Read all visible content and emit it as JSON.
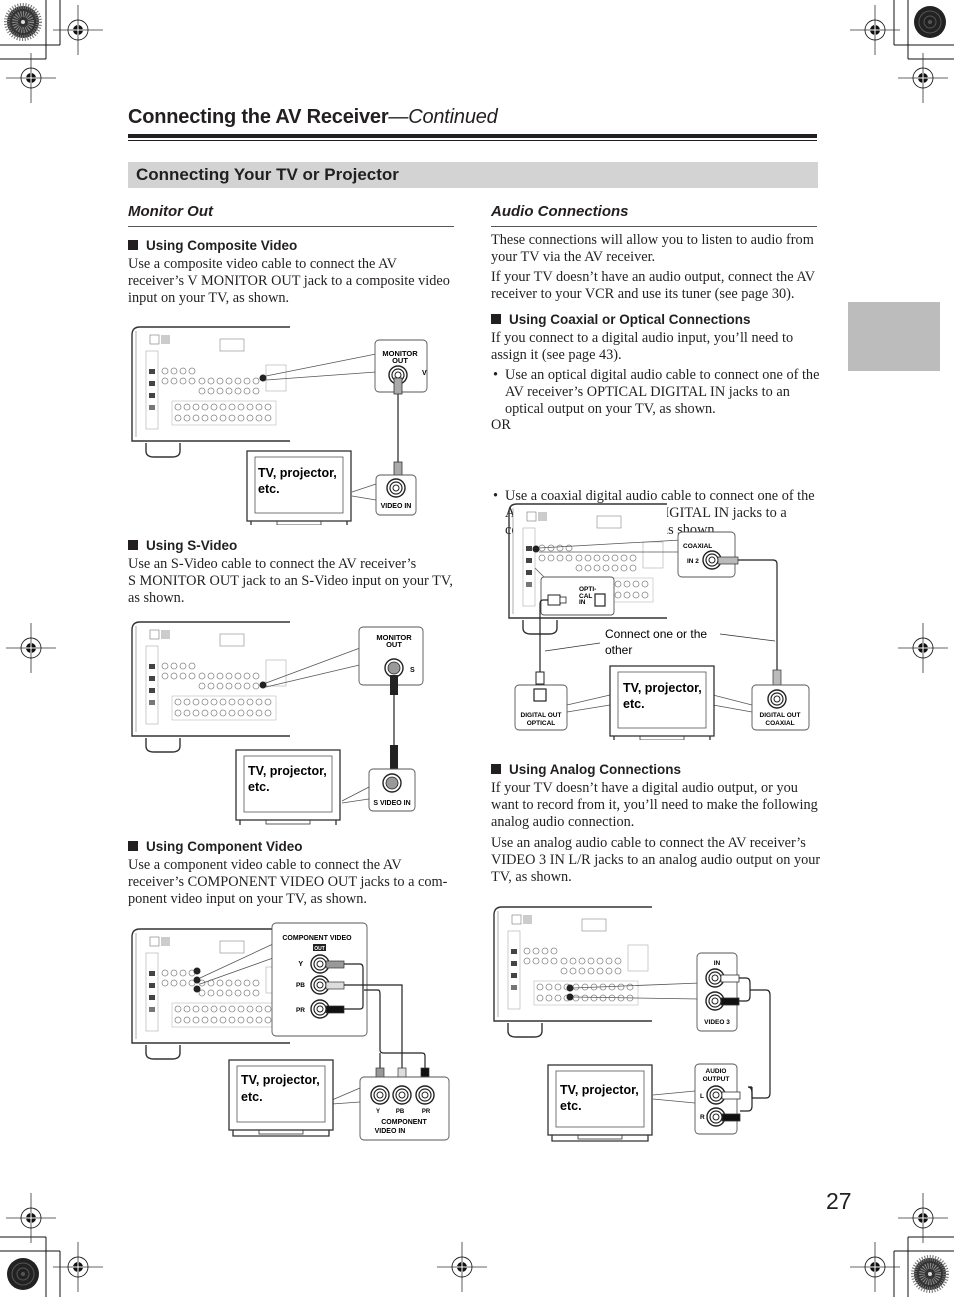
{
  "header": {
    "title": "Connecting the AV Receiver",
    "continued": "—Continued"
  },
  "section": {
    "title": "Connecting Your TV or Projector"
  },
  "left": {
    "subtitle": "Monitor Out",
    "composite": {
      "heading": "Using Composite Video",
      "body": "Use a composite video cable to connect the AV receiver’s V MONITOR OUT jack to a composite video input on your TV, as shown.",
      "diagram": {
        "out_label_1": "MONITOR",
        "out_label_2": "OUT",
        "out_jack": "V",
        "in_label": "VIDEO IN",
        "tv_line1": "TV, projector,",
        "tv_line2": "etc."
      }
    },
    "svideo": {
      "heading": "Using S-Video",
      "body_line1": "Use an S-Video cable to connect the AV receiver’s",
      "body_rest": "S MONITOR OUT jack to an S-Video input on your TV, as shown.",
      "diagram": {
        "out_label_1": "MONITOR",
        "out_label_2": "OUT",
        "out_jack": "S",
        "in_label": "S VIDEO IN",
        "tv_line1": "TV, projector,",
        "tv_line2": "etc."
      }
    },
    "component": {
      "heading": "Using Component Video",
      "body": "Use a component video cable to connect the AV receiver’s COMPONENT VIDEO OUT jacks to a com-ponent video input on your TV, as shown.",
      "diagram": {
        "out_title": "COMPONENT VIDEO",
        "out_badge": "OUT",
        "jack_y": "Y",
        "jack_pb": "PB",
        "jack_pr": "PR",
        "in_label_1": "COMPONENT",
        "in_label_2": "VIDEO  IN",
        "tv_line1": "TV, projector,",
        "tv_line2": "etc."
      }
    }
  },
  "right": {
    "subtitle": "Audio Connections",
    "intro_1": "These connections will allow you to listen to audio from your TV via the AV receiver.",
    "intro_2": "If your TV doesn’t have an audio output, connect the AV receiver to your VCR and use its tuner (see page 30).",
    "digital": {
      "heading": "Using Coaxial or Optical Connections",
      "body": "If you connect to a digital audio input, you’ll need to assign it (see page 43).",
      "bullet_1": "Use an optical digital audio cable to connect one of the AV receiver’s OPTICAL DIGITAL IN jacks to an optical output on your TV, as shown.",
      "or": "OR",
      "bullet_2": "Use a coaxial digital audio cable to connect one of the AV receiver’s COAXIAL DIGITAL IN jacks to a coaxial output on your TV, as shown.",
      "diagram": {
        "coax_title": "COAXIAL",
        "coax_jack": "IN 2",
        "opt_title_1": "OPTI-",
        "opt_title_2": "CAL",
        "opt_jack": "IN",
        "note_1": "Connect one or the",
        "note_2": "other",
        "opt_out_1": "DIGITAL OUT",
        "opt_out_2": "OPTICAL",
        "coax_out_1": "DIGITAL OUT",
        "coax_out_2": "COAXIAL",
        "tv_line1": "TV, projector,",
        "tv_line2": "etc."
      }
    },
    "analog": {
      "heading": "Using Analog Connections",
      "body_1": "If your TV doesn’t have a digital audio output, or you want to record from it, you’ll need to make the following analog audio connection.",
      "body_2": "Use an analog audio cable to connect the AV receiver’s VIDEO 3 IN L/R jacks to an analog audio output on your TV, as shown.",
      "diagram": {
        "in_title": "IN",
        "in_footer": "VIDEO 3",
        "out_title_1": "AUDIO",
        "out_title_2": "OUTPUT",
        "jack_l": "L",
        "jack_r": "R",
        "tv_line1": "TV, projector,",
        "tv_line2": "etc."
      }
    }
  },
  "page_number": "27",
  "colors": {
    "section_bar": "#d3d3d3",
    "side_tab": "#bcbcbc",
    "text": "#231f20"
  }
}
